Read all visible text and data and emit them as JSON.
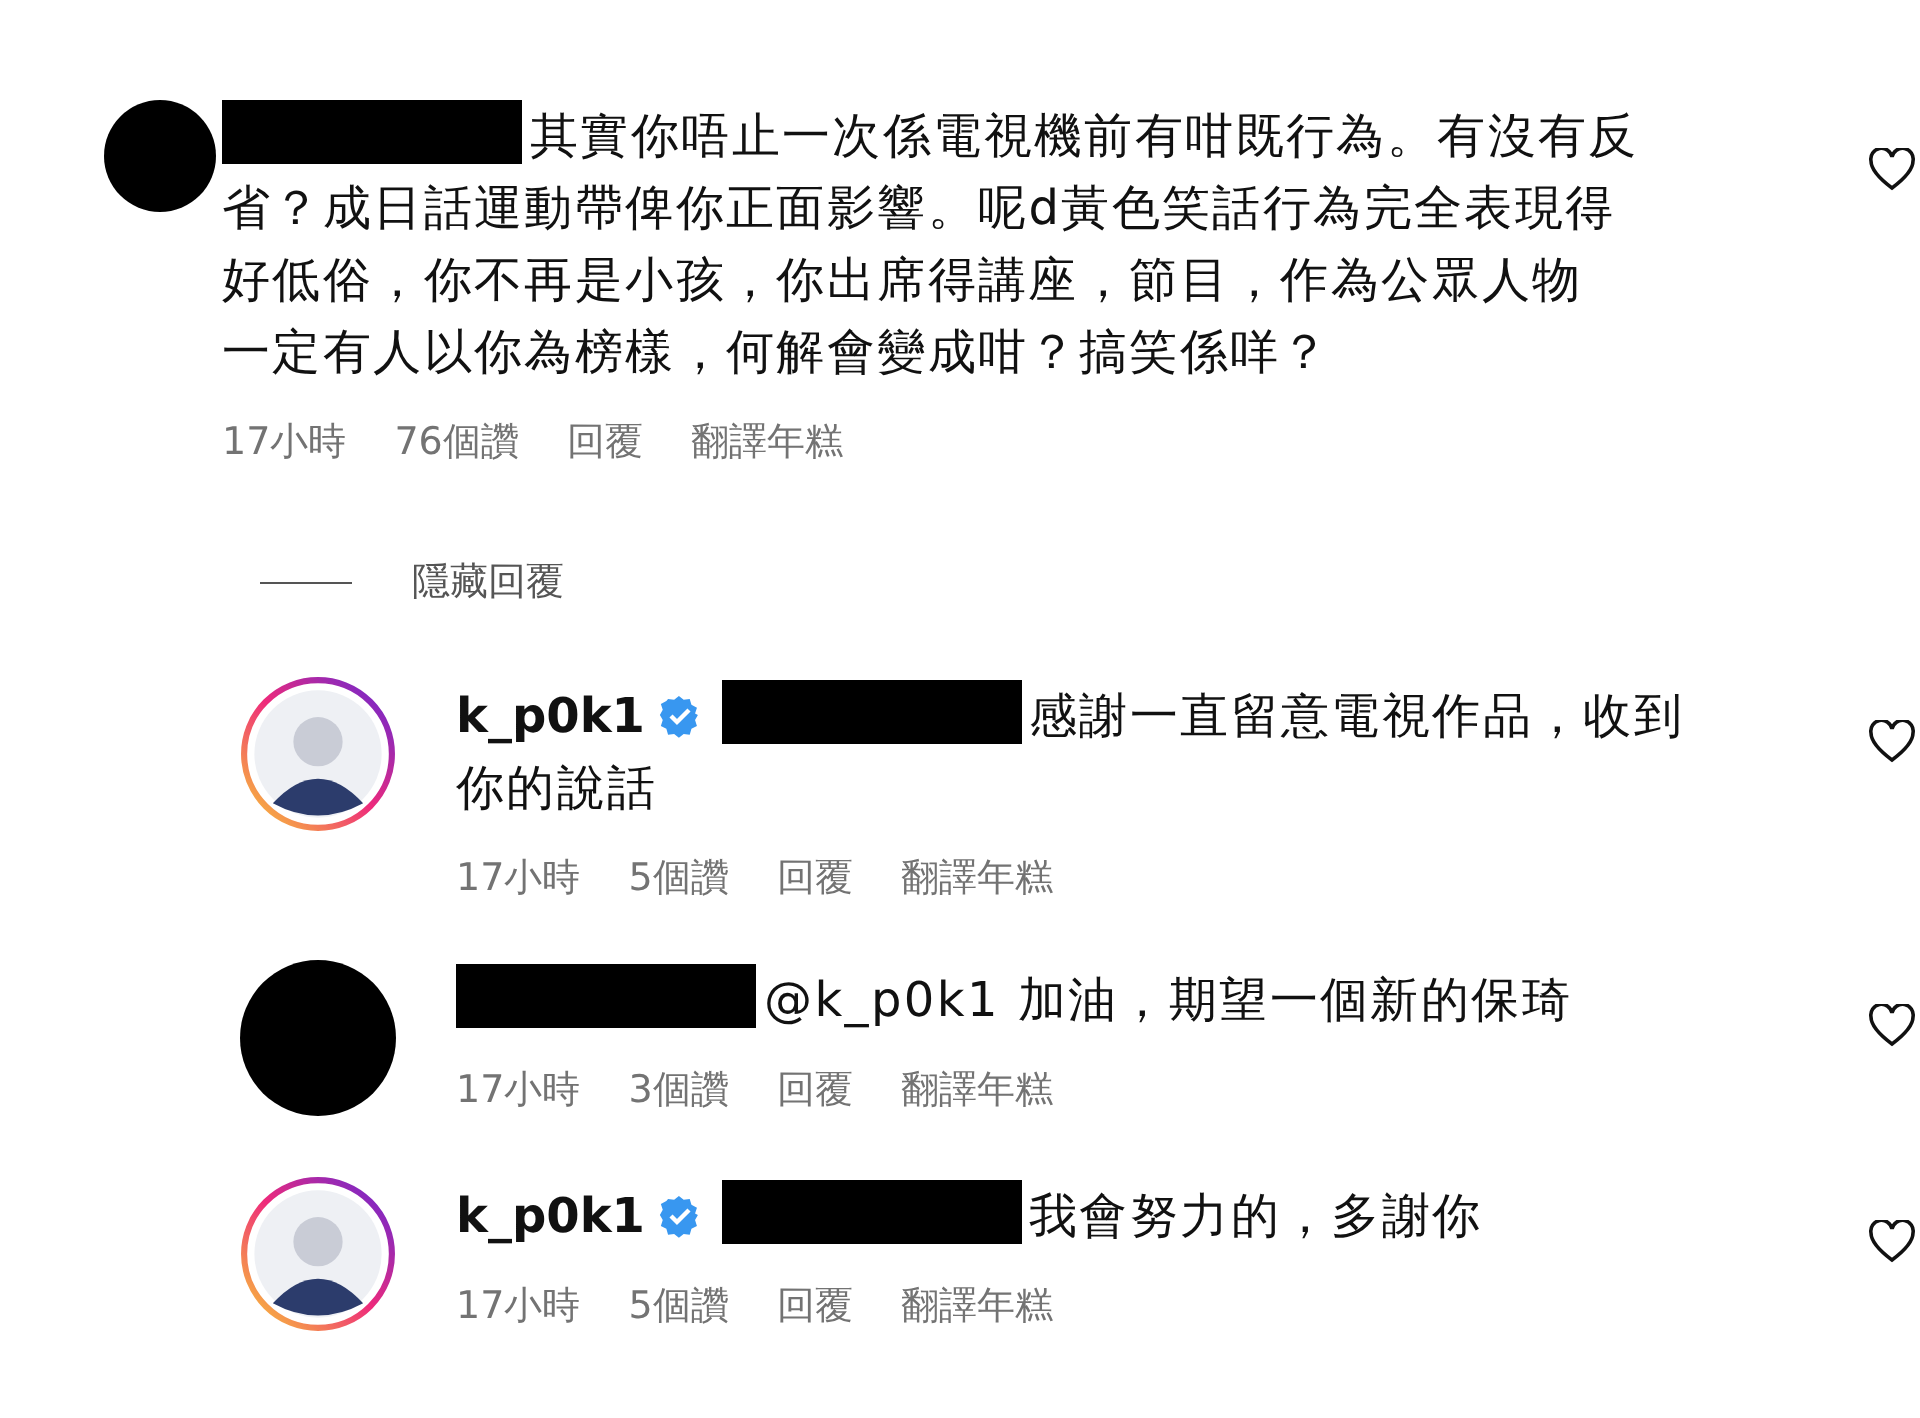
{
  "comment": {
    "kind": "redacted",
    "username_redacted": true,
    "lines": [
      "其實你唔止一次係電視機前有咁既行為。有沒有反",
      "省？成日話運動帶俾你正面影響。呢d黃色笑話行為完全表現得",
      "好低俗，你不再是小孩，你出席得講座，節目，作為公眾人物",
      "一定有人以你為榜樣，何解會變成咁？搞笑係咩？"
    ],
    "time": "17小時",
    "likes": "76個讚",
    "reply": "回覆",
    "translate": "翻譯年糕"
  },
  "hide_replies": "隱藏回覆",
  "replies": [
    {
      "kind": "profile",
      "username": "k_p0k1",
      "verified": true,
      "mention_redacted": true,
      "lines": [
        "感謝一直留意電視作品，收到",
        "你的說話"
      ],
      "time": "17小時",
      "likes": "5個讚",
      "reply": "回覆",
      "translate": "翻譯年糕"
    },
    {
      "kind": "redacted",
      "username_redacted": true,
      "lines": [
        "@k_p0k1 加油，期望一個新的保琦"
      ],
      "time": "17小時",
      "likes": "3個讚",
      "reply": "回覆",
      "translate": "翻譯年糕"
    },
    {
      "kind": "profile",
      "username": "k_p0k1",
      "verified": true,
      "mention_redacted": true,
      "lines": [
        "我會努力的，多謝你"
      ],
      "time": "17小時",
      "likes": "5個讚",
      "reply": "回覆",
      "translate": "翻譯年糕"
    }
  ]
}
